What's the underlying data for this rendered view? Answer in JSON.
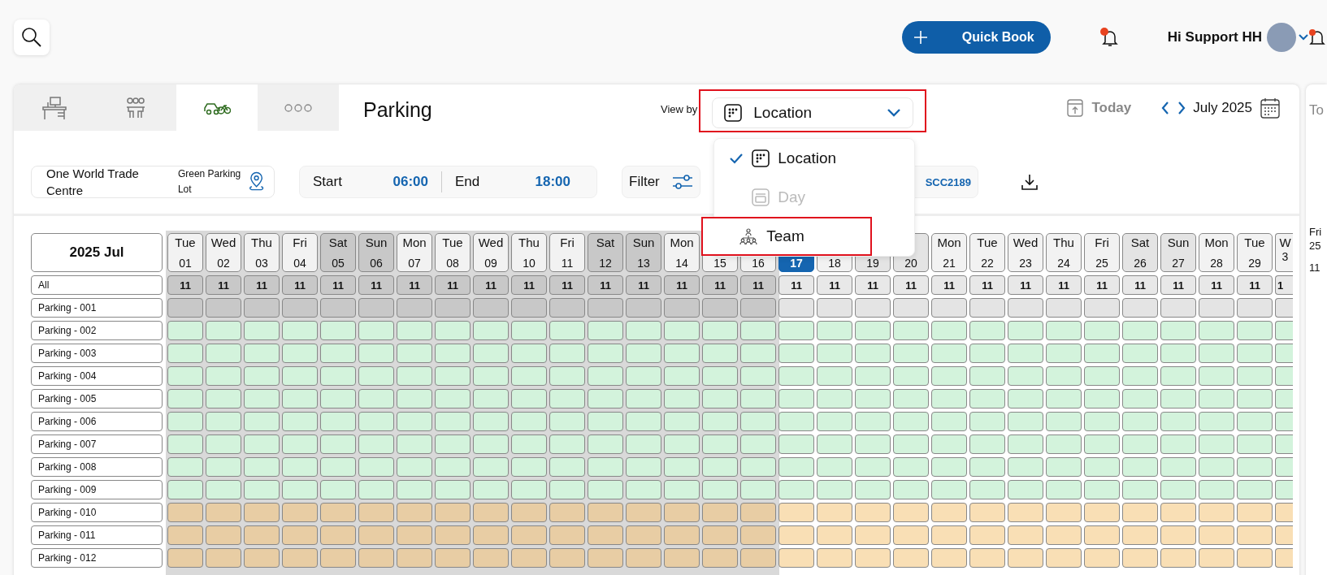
{
  "header": {
    "quick_book": "Quick Book",
    "greeting": "Hi Support HH",
    "notification_unread": true
  },
  "tabs": [
    {
      "kind": "desk",
      "selected": false
    },
    {
      "kind": "team",
      "selected": false
    },
    {
      "kind": "parking",
      "selected": true
    },
    {
      "kind": "more",
      "selected": false
    }
  ],
  "page_title": "Parking",
  "view_by": {
    "label": "View by",
    "value": "Location",
    "annotated": true,
    "expanded": true,
    "options": [
      {
        "label": "Location",
        "kind": "location",
        "selected": true,
        "disabled": false,
        "annotated": false
      },
      {
        "label": "Day",
        "kind": "day",
        "selected": false,
        "disabled": true,
        "annotated": false
      },
      {
        "label": "Team",
        "kind": "team",
        "selected": false,
        "disabled": false,
        "annotated": true
      }
    ]
  },
  "date_nav": {
    "today": "Today",
    "month": "July 2025"
  },
  "location": {
    "building": "One World Trade Centre",
    "lot": "Green Parking Lot"
  },
  "time": {
    "start_label": "Start",
    "start": "06:00",
    "end_label": "End",
    "end": "18:00"
  },
  "filter": {
    "label": "Filter"
  },
  "chip": "SCC2189",
  "calendar": {
    "month_label": "2025 Jul",
    "all_label": "All",
    "days": [
      {
        "weekday": "Tue",
        "day": "01",
        "count": "11",
        "past": true,
        "weekend": false,
        "selected": false
      },
      {
        "weekday": "Wed",
        "day": "02",
        "count": "11",
        "past": true,
        "weekend": false,
        "selected": false
      },
      {
        "weekday": "Thu",
        "day": "03",
        "count": "11",
        "past": true,
        "weekend": false,
        "selected": false
      },
      {
        "weekday": "Fri",
        "day": "04",
        "count": "11",
        "past": true,
        "weekend": false,
        "selected": false
      },
      {
        "weekday": "Sat",
        "day": "05",
        "count": "11",
        "past": true,
        "weekend": true,
        "selected": false
      },
      {
        "weekday": "Sun",
        "day": "06",
        "count": "11",
        "past": true,
        "weekend": true,
        "selected": false
      },
      {
        "weekday": "Mon",
        "day": "07",
        "count": "11",
        "past": true,
        "weekend": false,
        "selected": false
      },
      {
        "weekday": "Tue",
        "day": "08",
        "count": "11",
        "past": true,
        "weekend": false,
        "selected": false
      },
      {
        "weekday": "Wed",
        "day": "09",
        "count": "11",
        "past": true,
        "weekend": false,
        "selected": false
      },
      {
        "weekday": "Thu",
        "day": "10",
        "count": "11",
        "past": true,
        "weekend": false,
        "selected": false
      },
      {
        "weekday": "Fri",
        "day": "11",
        "count": "11",
        "past": true,
        "weekend": false,
        "selected": false
      },
      {
        "weekday": "Sat",
        "day": "12",
        "count": "11",
        "past": true,
        "weekend": true,
        "selected": false
      },
      {
        "weekday": "Sun",
        "day": "13",
        "count": "11",
        "past": true,
        "weekend": true,
        "selected": false
      },
      {
        "weekday": "Mon",
        "day": "14",
        "count": "11",
        "past": true,
        "weekend": false,
        "selected": false
      },
      {
        "day": "15",
        "count": "11",
        "past": true,
        "weekend": false,
        "selected": false
      },
      {
        "day": "16",
        "count": "11",
        "past": true,
        "weekend": false,
        "selected": false
      },
      {
        "day": "17",
        "count": "11",
        "past": false,
        "weekend": false,
        "selected": true
      },
      {
        "day": "18",
        "count": "11",
        "past": false,
        "weekend": false,
        "selected": false
      },
      {
        "day": "19",
        "count": "11",
        "past": false,
        "weekend": true,
        "selected": false
      },
      {
        "day": "20",
        "count": "11",
        "past": false,
        "weekend": true,
        "selected": false
      },
      {
        "weekday": "Mon",
        "day": "21",
        "count": "11",
        "past": false,
        "weekend": false,
        "selected": false
      },
      {
        "weekday": "Tue",
        "day": "22",
        "count": "11",
        "past": false,
        "weekend": false,
        "selected": false
      },
      {
        "weekday": "Wed",
        "day": "23",
        "count": "11",
        "past": false,
        "weekend": false,
        "selected": false
      },
      {
        "weekday": "Thu",
        "day": "24",
        "count": "11",
        "past": false,
        "weekend": false,
        "selected": false
      },
      {
        "weekday": "Fri",
        "day": "25",
        "count": "11",
        "past": false,
        "weekend": false,
        "selected": false
      },
      {
        "weekday": "Sat",
        "day": "26",
        "count": "11",
        "past": false,
        "weekend": true,
        "selected": false
      },
      {
        "weekday": "Sun",
        "day": "27",
        "count": "11",
        "past": false,
        "weekend": true,
        "selected": false
      },
      {
        "weekday": "Mon",
        "day": "28",
        "count": "11",
        "past": false,
        "weekend": false,
        "selected": false
      },
      {
        "weekday": "Tue",
        "day": "29",
        "count": "11",
        "past": false,
        "weekend": false,
        "selected": false
      },
      {
        "weekday": "W",
        "day": "3",
        "count": "1",
        "past": false,
        "weekend": false,
        "selected": false
      }
    ],
    "rows": [
      {
        "name": "Parking - 001",
        "kind": "blocked"
      },
      {
        "name": "Parking - 002",
        "kind": "free"
      },
      {
        "name": "Parking - 003",
        "kind": "free"
      },
      {
        "name": "Parking - 004",
        "kind": "free"
      },
      {
        "name": "Parking - 005",
        "kind": "free"
      },
      {
        "name": "Parking - 006",
        "kind": "free"
      },
      {
        "name": "Parking - 007",
        "kind": "free"
      },
      {
        "name": "Parking - 008",
        "kind": "free"
      },
      {
        "name": "Parking - 009",
        "kind": "free"
      },
      {
        "name": "Parking - 010",
        "kind": "reserved"
      },
      {
        "name": "Parking - 011",
        "kind": "reserved"
      },
      {
        "name": "Parking - 012",
        "kind": "reserved"
      }
    ]
  },
  "side_panel": {
    "title": "To",
    "weekday": "Fri",
    "day": "25",
    "count": "11"
  }
}
